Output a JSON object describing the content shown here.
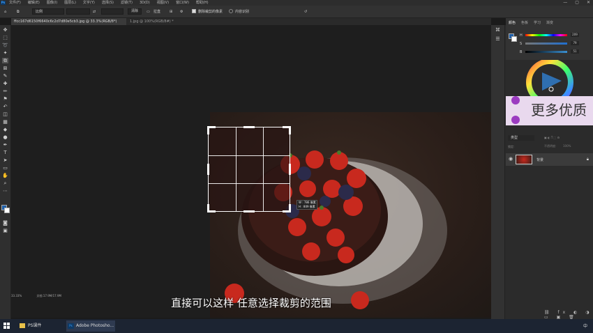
{
  "menubar": {
    "logo": "Ps",
    "items": [
      "文件(F)",
      "编辑(E)",
      "图像(I)",
      "图层(L)",
      "文字(Y)",
      "选择(S)",
      "滤镜(T)",
      "3D(D)",
      "视图(V)",
      "窗口(W)",
      "帮助(H)"
    ],
    "window_controls": [
      "—",
      "▢",
      "✕"
    ]
  },
  "options": {
    "ratio_label": "比例",
    "swap_icon": "⇄",
    "clear_label": "清除",
    "straighten_label": "拉直",
    "delete_cropped_label": "删除裁剪的像素",
    "content_aware_label": "内容识别"
  },
  "tabs": [
    {
      "label": "ffcc167d6150f6640c6c2d7d80e5cb3.jpg @ 33.3%(RGB/8*)"
    },
    {
      "label": "1.jpg @ 100%(RGB/8#) *"
    }
  ],
  "crop_tip": {
    "w": "W : 786 像素",
    "h": "H : 809 像素"
  },
  "subtitle": "直接可以这样 任意选择裁剪的范围",
  "status": {
    "zoom": "33.33%",
    "doc": "文档:17.9M/17.9M"
  },
  "color_panel": {
    "tabs": [
      "颜色",
      "色板",
      "学习",
      "渐变"
    ],
    "rows": [
      {
        "label": "H",
        "value": "209",
        "color": "#3a8fd0"
      },
      {
        "label": "S",
        "value": "79",
        "color": "#3a8fd0"
      },
      {
        "label": "B",
        "value": "51",
        "color": "#3a8fd0"
      }
    ]
  },
  "promo": {
    "text": "更多优质"
  },
  "layers": {
    "type_placeholder": "类型",
    "blend_mode": "正常",
    "opacity_label": "不透明度:",
    "opacity_value": "100%",
    "lock_label": "锁定:",
    "fill_label": "填充:",
    "fill_value": "100%",
    "layer_name": "背景"
  },
  "taskbar": {
    "items": [
      {
        "label": "PS课件",
        "icon": "folder-icon"
      },
      {
        "label": "Adobe Photosho...",
        "icon": "photoshop-icon"
      }
    ],
    "time": "中",
    "lang": "中"
  },
  "colors": {
    "accent": "#3a8fd0",
    "promo_bg": "#e9d9ee",
    "promo_dot": "#9b3bc0"
  }
}
